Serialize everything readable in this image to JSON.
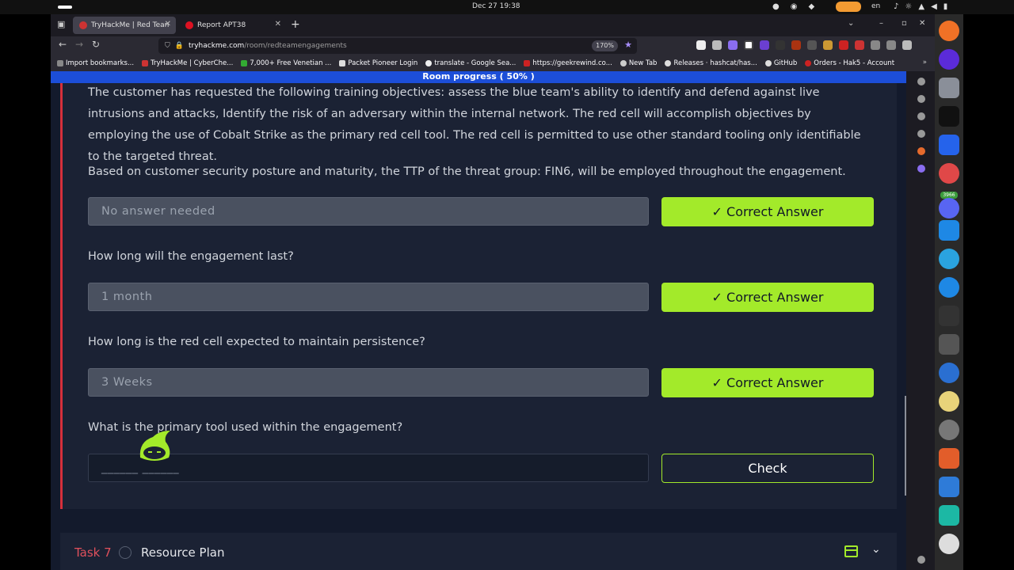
{
  "os": {
    "clock": "Dec 27  19:38",
    "lang": "en"
  },
  "browser": {
    "tabs": [
      {
        "label": "TryHackMe | Red Tean",
        "active": true
      },
      {
        "label": "Report APT38",
        "active": false
      }
    ],
    "url_host": "tryhackme.com",
    "url_path": "/room/redteamengagements",
    "zoom": "170%",
    "bookmarks": [
      "Import bookmarks...",
      "TryHackMe | CyberChe...",
      "7,000+ Free Venetian ...",
      "Packet Pioneer Login",
      "translate - Google Sea...",
      "https://geekrewind.co...",
      "New Tab",
      "Releases · hashcat/has...",
      "GitHub",
      "Orders - Hak5 - Account"
    ]
  },
  "page": {
    "progress_banner": "Room progress ( 50% )",
    "paragraph1": "The customer has requested the following training objectives: assess the blue team's ability to identify and defend against live intrusions and attacks, Identify the risk of an adversary within the internal network. The red cell will accomplish objectives by employing the use of Cobalt Strike as the primary red cell tool. The red cell is permitted to use other standard tooling only identifiable to the targeted threat.",
    "paragraph2": "Based on customer security posture and maturity, the TTP of the threat group: FIN6, will be employed throughout the engagement.",
    "questions": [
      {
        "question": "",
        "answer": "No answer needed",
        "button": "Correct Answer"
      },
      {
        "question": "How long will the engagement last?",
        "answer": "1 month",
        "button": "Correct Answer"
      },
      {
        "question": "How long is the red cell expected to maintain persistence?",
        "answer": "3 Weeks",
        "button": "Correct Answer"
      },
      {
        "question": "What is the primary tool used within the engagement?",
        "placeholder": "______ ______",
        "button": "Check"
      }
    ],
    "next_task": {
      "number": "Task 7",
      "title": "Resource Plan"
    }
  },
  "colors": {
    "accent_green": "#a3ea2a",
    "task_red": "#d6303b",
    "banner_blue": "#1c4ed8",
    "page_bg": "#131a2c"
  }
}
